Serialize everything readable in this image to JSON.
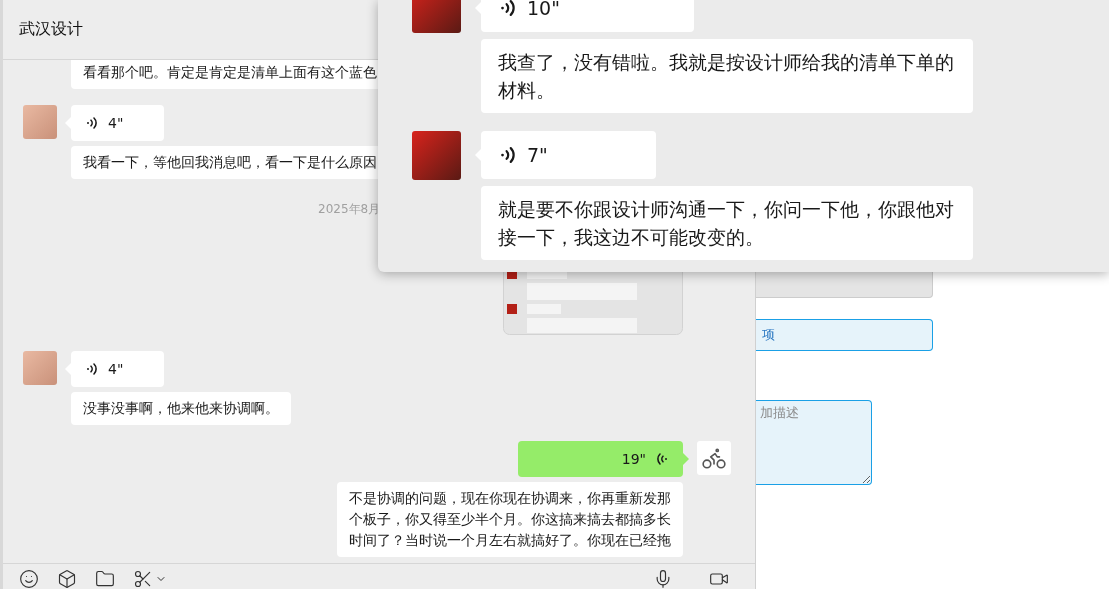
{
  "chat": {
    "title": "武汉设计",
    "messages": [
      {
        "kind": "text",
        "text": "看看那个吧。肯定是肯定是清单上面有这个蓝色"
      },
      {
        "kind": "voice",
        "outgoing": false,
        "avatar": true,
        "duration": "4\""
      },
      {
        "kind": "text",
        "text": "我看一下，等他回我消息吧，看一下是什么原因"
      },
      {
        "kind": "time",
        "text": "2025年8月"
      },
      {
        "kind": "image",
        "outgoing": true
      },
      {
        "kind": "voice",
        "outgoing": false,
        "avatar": true,
        "duration": "4\""
      },
      {
        "kind": "text",
        "text": "没事没事啊，他来他来协调啊。"
      },
      {
        "kind": "voice",
        "outgoing": true,
        "avatar": true,
        "duration": "19\""
      },
      {
        "kind": "text",
        "text": "不是协调的问题，现在你现在协调来，你再重新发那个板子，你又得至少半个月。你这搞来搞去都搞多长时间了？当时说一个月左右就搞好了。你现在已经拖"
      }
    ]
  },
  "form": {
    "option_field": {
      "value": "项"
    },
    "description_field": {
      "placeholder": "加描述"
    }
  },
  "image_preview": {
    "messages": [
      {
        "kind": "voice",
        "avatar": true,
        "duration": "10\""
      },
      {
        "kind": "text",
        "text": "我查了，没有错啦。我就是按设计师给我的清单下单的材料。"
      },
      {
        "kind": "voice",
        "avatar": true,
        "duration": "7\""
      },
      {
        "kind": "text",
        "text": "就是要不你跟设计师沟通一下，你问一下他，你跟他对接一下，我这边不可能改变的。"
      }
    ]
  }
}
